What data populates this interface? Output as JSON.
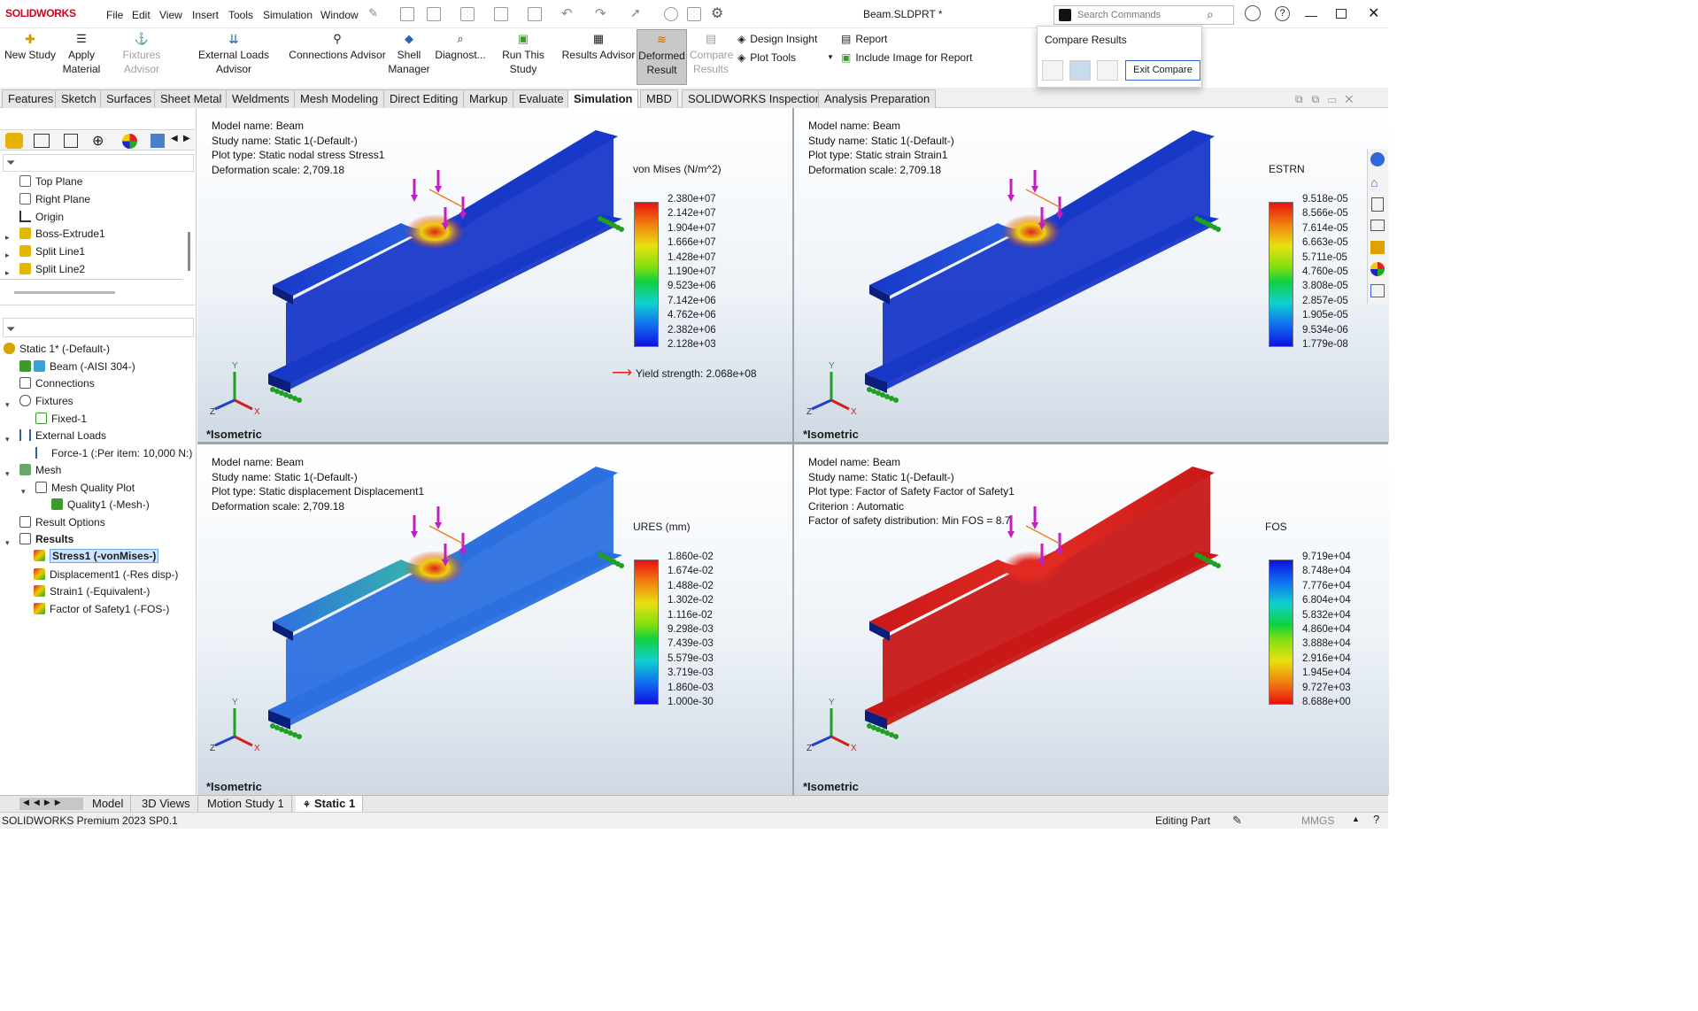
{
  "app": {
    "logo": "SOLIDWORKS",
    "document_title": "Beam.SLDPRT *",
    "search_placeholder": "Search Commands"
  },
  "menu": [
    "File",
    "Edit",
    "View",
    "Insert",
    "Tools",
    "Simulation",
    "Window"
  ],
  "toolbar": {
    "new_study": "New Study",
    "apply_material": "Apply Material",
    "fixtures_advisor": "Fixtures Advisor",
    "external_loads_advisor": "External Loads Advisor",
    "connections_advisor": "Connections Advisor",
    "shell_manager": "Shell Manager",
    "diagnostics": "Diagnost...",
    "run_study": "Run This Study",
    "results_advisor": "Results Advisor",
    "deformed_result": "Deformed Result",
    "compare_results": "Compare Results",
    "design_insight": "Design Insight",
    "plot_tools": "Plot Tools",
    "report": "Report",
    "include_image": "Include Image for Report"
  },
  "tabs": [
    "Features",
    "Sketch",
    "Surfaces",
    "Sheet Metal",
    "Weldments",
    "Mesh Modeling",
    "Direct Editing",
    "Markup",
    "Evaluate",
    "Simulation",
    "MBD",
    "SOLIDWORKS Inspection",
    "Analysis Preparation"
  ],
  "active_tab": "Simulation",
  "compare_popup": {
    "title": "Compare Results",
    "exit_label": "Exit Compare"
  },
  "feature_tree": [
    "Top Plane",
    "Right Plane",
    "Origin",
    "Boss-Extrude1",
    "Split Line1",
    "Split Line2"
  ],
  "study_tree": {
    "study": "Static 1* (-Default-)",
    "beam": "Beam (-AISI 304-)",
    "connections": "Connections",
    "fixtures": "Fixtures",
    "fixed": "Fixed-1",
    "external_loads": "External Loads",
    "force": "Force-1 (:Per item: 10,000 N:)",
    "mesh": "Mesh",
    "mesh_quality_plot": "Mesh Quality Plot",
    "quality": "Quality1 (-Mesh-)",
    "result_options": "Result Options",
    "results": "Results",
    "stress": "Stress1 (-vonMises-)",
    "displacement": "Displacement1 (-Res disp-)",
    "strain": "Strain1 (-Equivalent-)",
    "fos": "Factor of Safety1 (-FOS-)"
  },
  "viewports": [
    {
      "info": [
        "Model name: Beam",
        "Study name: Static 1(-Default-)",
        "Plot type: Static nodal stress Stress1",
        "Deformation scale: 2,709.18"
      ],
      "legend_title": "von Mises (N/m^2)",
      "ticks": [
        "2.380e+07",
        "2.142e+07",
        "1.904e+07",
        "1.666e+07",
        "1.428e+07",
        "1.190e+07",
        "9.523e+06",
        "7.142e+06",
        "4.762e+06",
        "2.382e+06",
        "2.128e+03"
      ],
      "yield": "Yield strength: 2.068e+08",
      "view": "*Isometric"
    },
    {
      "info": [
        "Model name: Beam",
        "Study name: Static 1(-Default-)",
        "Plot type: Static strain Strain1",
        "Deformation scale: 2,709.18"
      ],
      "legend_title": "ESTRN",
      "ticks": [
        "9.518e-05",
        "8.566e-05",
        "7.614e-05",
        "6.663e-05",
        "5.711e-05",
        "4.760e-05",
        "3.808e-05",
        "2.857e-05",
        "1.905e-05",
        "9.534e-06",
        "1.779e-08"
      ],
      "view": "*Isometric"
    },
    {
      "info": [
        "Model name: Beam",
        "Study name: Static 1(-Default-)",
        "Plot type: Static displacement Displacement1",
        "Deformation scale: 2,709.18"
      ],
      "legend_title": "URES (mm)",
      "ticks": [
        "1.860e-02",
        "1.674e-02",
        "1.488e-02",
        "1.302e-02",
        "1.116e-02",
        "9.298e-03",
        "7.439e-03",
        "5.579e-03",
        "3.719e-03",
        "1.860e-03",
        "1.000e-30"
      ],
      "view": "*Isometric"
    },
    {
      "info": [
        "Model name: Beam",
        "Study name: Static 1(-Default-)",
        "Plot type: Factor of Safety Factor of Safety1",
        "Criterion : Automatic",
        "Factor of safety distribution: Min FOS = 8.7"
      ],
      "legend_title": "FOS",
      "ticks": [
        "9.719e+04",
        "8.748e+04",
        "7.776e+04",
        "6.804e+04",
        "5.832e+04",
        "4.860e+04",
        "3.888e+04",
        "2.916e+04",
        "1.945e+04",
        "9.727e+03",
        "8.688e+00"
      ],
      "view": "*Isometric"
    }
  ],
  "bottom_tabs": [
    "Model",
    "3D Views",
    "Motion Study 1",
    "Static 1"
  ],
  "status": {
    "product": "SOLIDWORKS Premium 2023 SP0.1",
    "mode": "Editing Part",
    "units": "MMGS"
  },
  "colors": {
    "accent": "#d0021b",
    "selected": "#cfe5ff",
    "beam_low": "#1030d0",
    "beam_high": "#d01818"
  }
}
